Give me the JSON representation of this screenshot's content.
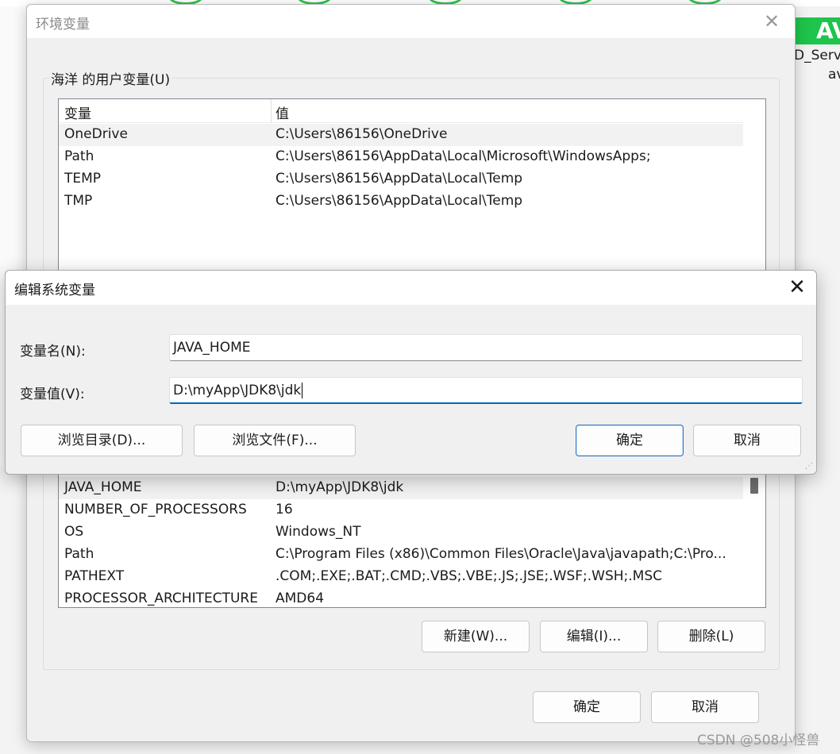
{
  "background": {
    "badge_text": "AV",
    "text_line1": "D_Servl",
    "text_line2": "av"
  },
  "outer_dialog": {
    "title": "环境变量",
    "close_glyph": "✕",
    "user_group_label": "海洋 的用户变量(U)",
    "columns": {
      "name": "变量",
      "value": "值"
    },
    "user_vars": [
      {
        "name": "OneDrive",
        "value": "C:\\Users\\86156\\OneDrive"
      },
      {
        "name": "Path",
        "value": "C:\\Users\\86156\\AppData\\Local\\Microsoft\\WindowsApps;"
      },
      {
        "name": "TEMP",
        "value": "C:\\Users\\86156\\AppData\\Local\\Temp"
      },
      {
        "name": "TMP",
        "value": "C:\\Users\\86156\\AppData\\Local\\Temp"
      }
    ],
    "system_vars": [
      {
        "name": "JAVA_HOME",
        "value": "D:\\myApp\\JDK8\\jdk"
      },
      {
        "name": "NUMBER_OF_PROCESSORS",
        "value": "16"
      },
      {
        "name": "OS",
        "value": "Windows_NT"
      },
      {
        "name": "Path",
        "value": "C:\\Program Files (x86)\\Common Files\\Oracle\\Java\\javapath;C:\\Pro..."
      },
      {
        "name": "PATHEXT",
        "value": ".COM;.EXE;.BAT;.CMD;.VBS;.VBE;.JS;.JSE;.WSF;.WSH;.MSC"
      },
      {
        "name": "PROCESSOR_ARCHITECTURE",
        "value": "AMD64"
      }
    ],
    "sys_buttons": {
      "new": "新建(W)...",
      "edit": "编辑(I)...",
      "delete": "删除(L)"
    },
    "ok": "确定",
    "cancel": "取消"
  },
  "edit_dialog": {
    "title": "编辑系统变量",
    "close_glyph": "✕",
    "name_label": "变量名(N):",
    "name_value": "JAVA_HOME",
    "value_label": "变量值(V):",
    "value_value": "D:\\myApp\\JDK8\\jdk",
    "browse_dir": "浏览目录(D)...",
    "browse_file": "浏览文件(F)...",
    "ok": "确定",
    "cancel": "取消"
  },
  "watermark": "CSDN @508小怪兽"
}
